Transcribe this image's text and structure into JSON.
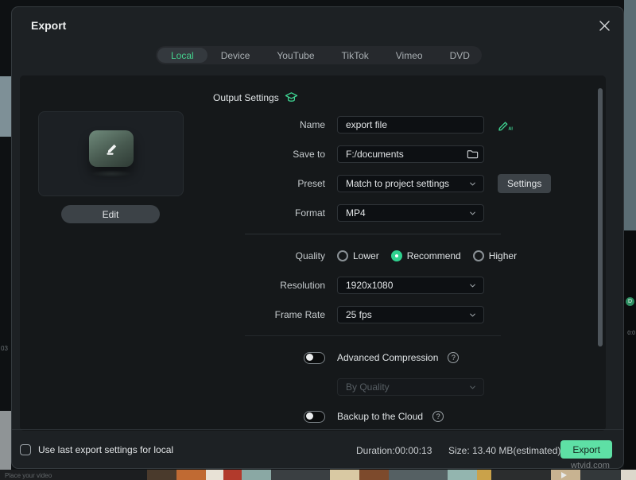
{
  "window": {
    "title": "Export"
  },
  "tabs": [
    {
      "label": "Local"
    },
    {
      "label": "Device"
    },
    {
      "label": "YouTube"
    },
    {
      "label": "TikTok"
    },
    {
      "label": "Vimeo"
    },
    {
      "label": "DVD"
    }
  ],
  "selected_tab": "Local",
  "preview": {
    "edit_label": "Edit"
  },
  "output": {
    "header": "Output Settings",
    "name_label": "Name",
    "name_value": "export file",
    "save_label": "Save to",
    "save_value": "F:/documents",
    "preset_label": "Preset",
    "preset_value": "Match to project settings",
    "settings_button": "Settings",
    "format_label": "Format",
    "format_value": "MP4",
    "quality_label": "Quality",
    "quality_lower": "Lower",
    "quality_recommend": "Recommend",
    "quality_higher": "Higher",
    "quality_selected": "Recommend",
    "resolution_label": "Resolution",
    "resolution_value": "1920x1080",
    "framerate_label": "Frame Rate",
    "framerate_value": "25 fps",
    "adv_compression_label": "Advanced Compression",
    "adv_compression_state": "off",
    "by_quality_value": "By Quality",
    "backup_label": "Backup to the Cloud",
    "backup_state": "off",
    "help_icon": "?",
    "ai_icon_label": "AI"
  },
  "footer": {
    "checkbox_label": "Use last export settings for local",
    "checkbox_checked": "false",
    "duration": "Duration:00:00:13",
    "size": "Size: 13.40 MB(estimated)",
    "export_button": "Export"
  },
  "background": {
    "timeline_text": "Place your video"
  },
  "watermark": "wtvid.com",
  "colors": {
    "accent_green": "#45d08e",
    "export_button_green": "#5ee0a5"
  }
}
